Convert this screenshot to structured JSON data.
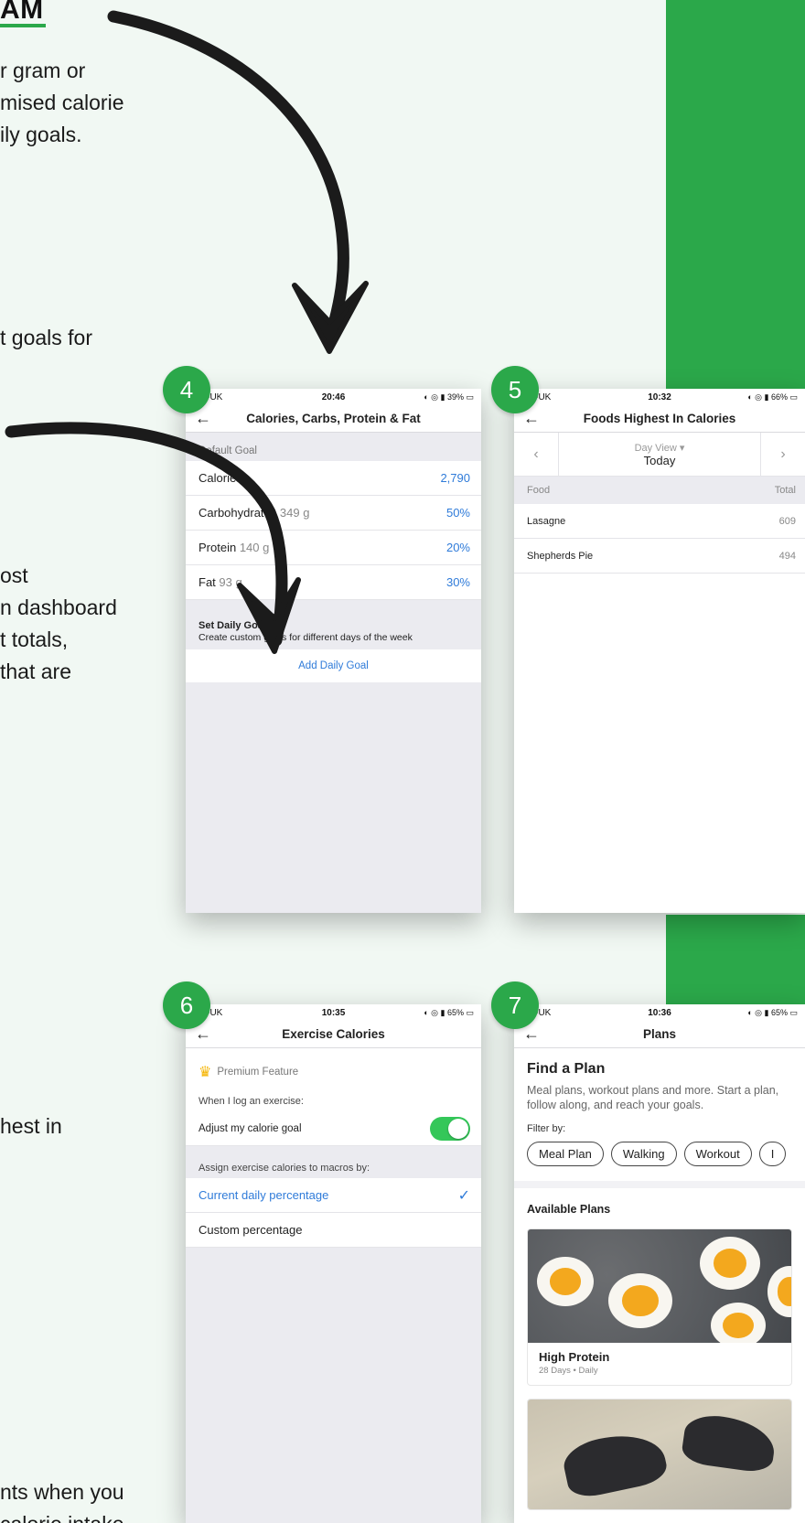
{
  "left_text": {
    "title_fragment": "AM",
    "para1": [
      "r gram or",
      "mised calorie",
      "ily goals."
    ],
    "para2": [
      "t goals for"
    ],
    "para3": [
      "ost",
      "n dashboard",
      "t totals,",
      " that are"
    ],
    "para4": [
      "hest in"
    ],
    "para5": [
      "nts when you",
      "calorie intake"
    ]
  },
  "screens": [
    {
      "badge": "4",
      "status": {
        "carrier": "02-UK",
        "time": "20:46",
        "right": "◐ ◎ ▮ 39% ▭"
      },
      "nav_title": "Calories, Carbs, Protein & Fat",
      "section_label": "Default Goal",
      "rows": [
        {
          "label": "Calories",
          "sub": "",
          "value": "2,790"
        },
        {
          "label": "Carbohydrates",
          "sub": "349 g",
          "value": "50%"
        },
        {
          "label": "Protein",
          "sub": "140 g",
          "value": "20%"
        },
        {
          "label": "Fat",
          "sub": "93 g",
          "value": "30%"
        }
      ],
      "hint_title": "Set Daily Goals",
      "hint_text": "Create custom goals for different days of the week",
      "add_label": "Add Daily Goal"
    },
    {
      "badge": "5",
      "status": {
        "carrier": "02-UK",
        "time": "10:32",
        "right": "◐ ◎ ▮ 66% ▭"
      },
      "nav_title": "Foods Highest In Calories",
      "day_view": "Day View",
      "day_label": "Today",
      "col_food": "Food",
      "col_total": "Total",
      "foods": [
        {
          "name": "Lasagne",
          "total": "609"
        },
        {
          "name": "Shepherds Pie",
          "total": "494"
        }
      ]
    },
    {
      "badge": "6",
      "status": {
        "carrier": "02-UK",
        "time": "10:35",
        "right": "◐ ◎ ▮ 65% ▭"
      },
      "nav_title": "Exercise Calories",
      "premium": "Premium Feature",
      "when_label": "When I log an exercise:",
      "adjust_label": "Adjust my calorie goal",
      "adjust_on": true,
      "assign_label": "Assign exercise calories to macros by:",
      "option_current": "Current daily percentage",
      "option_custom": "Custom percentage"
    },
    {
      "badge": "7",
      "status": {
        "carrier": "02-UK",
        "time": "10:36",
        "right": "◐ ◎ ▮ 65% ▭"
      },
      "nav_title": "Plans",
      "heading": "Find a Plan",
      "description": "Meal plans, workout plans and more. Start a plan, follow along, and reach your goals.",
      "filter_label": "Filter by:",
      "chips": [
        "Meal Plan",
        "Walking",
        "Workout",
        "I"
      ],
      "available_label": "Available Plans",
      "plan_name": "High Protein",
      "plan_meta": "28 Days • Daily"
    }
  ],
  "colors": {
    "accent_green": "#2ba84a",
    "link_blue": "#2f7bd9",
    "page_bg": "#f1f8f3"
  }
}
